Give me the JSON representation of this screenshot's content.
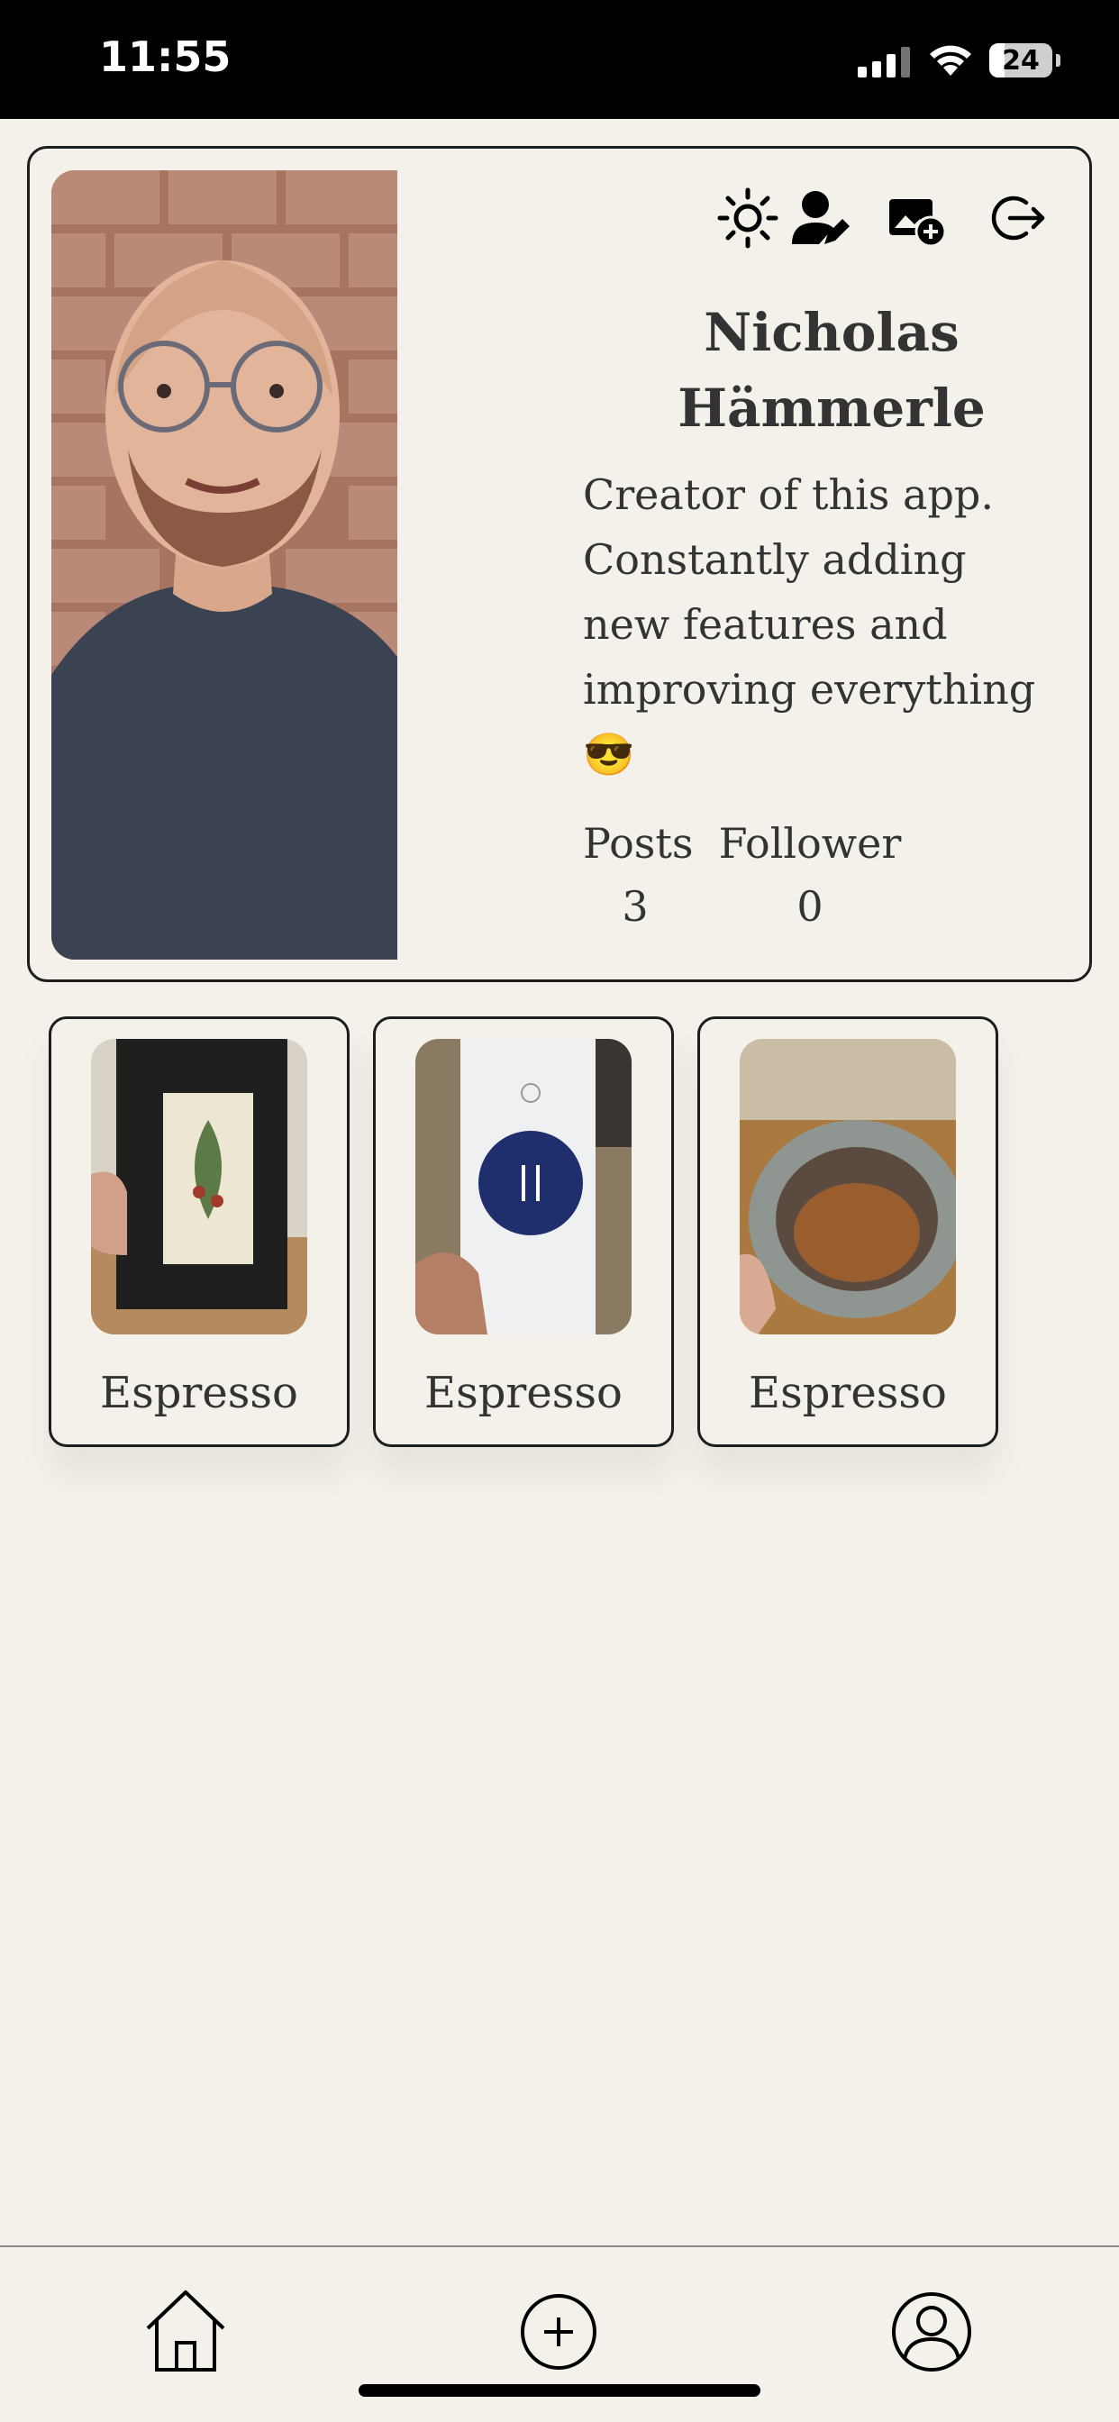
{
  "status_bar": {
    "time": "11:55",
    "battery": "24",
    "icons": [
      "signal-icon",
      "wifi-icon",
      "battery-icon"
    ]
  },
  "profile": {
    "avatar_icon": "profile-photo",
    "actions": [
      {
        "name": "theme-toggle",
        "icon": "sun-icon"
      },
      {
        "name": "edit-profile",
        "icon": "user-edit-icon"
      },
      {
        "name": "add-photo",
        "icon": "image-add-icon"
      },
      {
        "name": "logout",
        "icon": "logout-icon"
      }
    ],
    "name_line1": "Nicholas",
    "name_line2": "Hämmerle",
    "bio": [
      "Creator of this app.",
      "Constantly adding",
      "new features and",
      "improving everything",
      "😎"
    ],
    "stats": {
      "posts_label": "Posts",
      "posts_value": "3",
      "follower_label": "Follower",
      "follower_value": "0"
    }
  },
  "posts": [
    {
      "label": "Espresso",
      "image": "coffee-bag-black"
    },
    {
      "label": "Espresso",
      "image": "coffee-bag-white"
    },
    {
      "label": "Espresso",
      "image": "espresso-cup"
    }
  ],
  "bottom_nav": {
    "items": [
      {
        "name": "home",
        "icon": "home-icon"
      },
      {
        "name": "add-post",
        "icon": "plus-circle-icon"
      },
      {
        "name": "profile",
        "icon": "user-circle-icon"
      }
    ]
  },
  "colors": {
    "background": "#f4f1ea",
    "border": "#1d1d1d",
    "text": "#333333"
  }
}
